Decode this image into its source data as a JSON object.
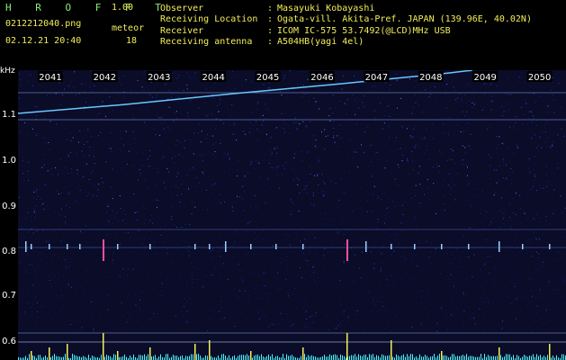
{
  "app": {
    "brand": "H R O F F T",
    "version": "1.00",
    "filename": "0212212040.png",
    "datetime": "02.12.21 20:40",
    "meteor_label": "meteor",
    "meteor_count": "18"
  },
  "info": {
    "observer_label": "Observer",
    "observer_value": "Masayuki Kobayashi",
    "location_label": "Receiving Location",
    "location_value": "Ogata-vill. Akita-Pref. JAPAN (139.96E, 40.02N)",
    "receiver_label": "Receiver",
    "receiver_value": "ICOM IC-575 53.7492(@LCD)MHz USB",
    "antenna_label": "Receiving antenna",
    "antenna_value": "A504HB(yagi 4el)",
    "separator": ":"
  },
  "spectrogram": {
    "unit_label": "kHz",
    "time_labels": [
      "2041",
      "2042",
      "2043",
      "2044",
      "2045",
      "2046",
      "2047",
      "2048",
      "2049",
      "2050"
    ],
    "freq_labels": [
      "1.1",
      "1.0",
      "0.9",
      "0.8",
      "0.7",
      "0.6"
    ],
    "colors": {
      "noise": "#1c2da8",
      "trace": "#69c8ff",
      "meteor": "#ff4fa0",
      "hline": "#4d5d8e",
      "amplitude": "#f2ef5d",
      "baseline": "#4ef6ff"
    }
  }
}
